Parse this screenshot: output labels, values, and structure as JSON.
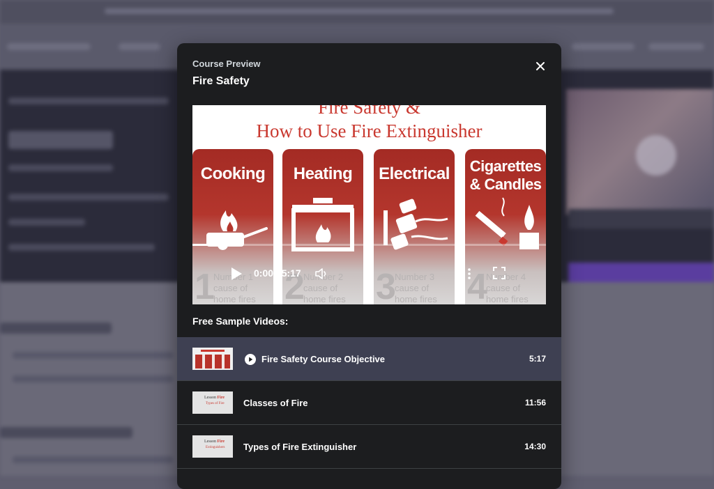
{
  "modal": {
    "eyebrow": "Course Preview",
    "title": "Fire Safety",
    "close_icon": "close-icon"
  },
  "video": {
    "title_line1": "Fire Safety &",
    "title_line2": "How to Use Fire Extinguisher",
    "cards": [
      {
        "label": "Cooking",
        "number": "1",
        "caption": [
          "Number 1",
          "cause of",
          "home fires"
        ]
      },
      {
        "label": "Heating",
        "number": "2",
        "caption": [
          "Number 2",
          "cause of",
          "home fires"
        ]
      },
      {
        "label": "Electrical",
        "number": "3",
        "caption": [
          "Number 3",
          "cause of",
          "home fires"
        ]
      },
      {
        "label_lines": [
          "Cigarettes",
          "& Candles"
        ],
        "number": "4",
        "caption": [
          "Number 4",
          "cause of",
          "home fires"
        ]
      }
    ],
    "time": "0:00 / 5:17",
    "progress": 0,
    "accent_color": "#c9382f"
  },
  "samples": {
    "heading": "Free Sample Videos:",
    "items": [
      {
        "label": "Fire Safety Course Objective",
        "duration": "5:17",
        "active": true
      },
      {
        "label": "Classes of Fire",
        "duration": "11:56",
        "thumb_title": "Lesson",
        "thumb_title_red": "Fire",
        "thumb_sub": "Types of Fire"
      },
      {
        "label": "Types of Fire Extinguisher",
        "duration": "14:30",
        "thumb_title": "Lesson",
        "thumb_title_red": "Fire",
        "thumb_sub": "Extinguishers"
      }
    ]
  }
}
